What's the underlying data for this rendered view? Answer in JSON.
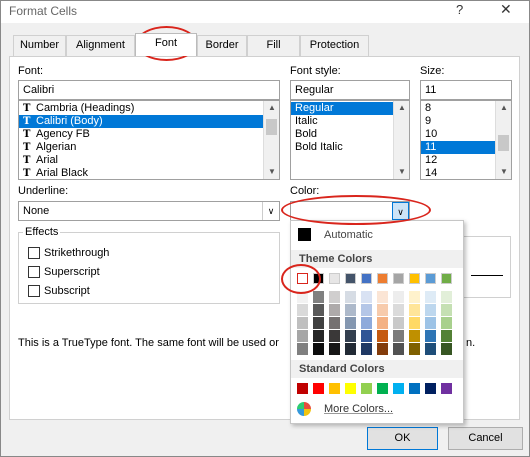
{
  "window": {
    "title": "Format Cells",
    "help": "?",
    "close": "✕"
  },
  "tabs": [
    "Number",
    "Alignment",
    "Font",
    "Border",
    "Fill",
    "Protection"
  ],
  "font": {
    "label": "Font:",
    "value": "Calibri",
    "items": [
      "Cambria (Headings)",
      "Calibri (Body)",
      "Agency FB",
      "Algerian",
      "Arial",
      "Arial Black"
    ],
    "selected_index": 1
  },
  "font_style": {
    "label": "Font style:",
    "value": "Regular",
    "items": [
      "Regular",
      "Italic",
      "Bold",
      "Bold Italic"
    ],
    "selected_index": 0
  },
  "size": {
    "label": "Size:",
    "value": "11",
    "items": [
      "8",
      "9",
      "10",
      "11",
      "12",
      "14"
    ],
    "selected_index": 3
  },
  "underline": {
    "label": "Underline:",
    "value": "None"
  },
  "color": {
    "label": "Color:"
  },
  "effects": {
    "label": "Effects",
    "strikethrough": "Strikethrough",
    "superscript": "Superscript",
    "subscript": "Subscript"
  },
  "info_text": "This is a TrueType font.  The same font will be used or",
  "info_text_tail": "n.",
  "color_popup": {
    "automatic": "Automatic",
    "theme_colors": "Theme Colors",
    "standard_colors": "Standard Colors",
    "more_colors": "More Colors...",
    "theme_row": [
      "#ffffff",
      "#000000",
      "#e7e6e6",
      "#44546a",
      "#4472c4",
      "#ed7d31",
      "#a5a5a5",
      "#ffc000",
      "#5b9bd5",
      "#70ad47"
    ],
    "theme_columns": [
      [
        "#f2f2f2",
        "#d9d9d9",
        "#bfbfbf",
        "#a6a6a6",
        "#808080"
      ],
      [
        "#808080",
        "#595959",
        "#404040",
        "#262626",
        "#0d0d0d"
      ],
      [
        "#d0cece",
        "#aeaaaa",
        "#757171",
        "#3a3838",
        "#171616"
      ],
      [
        "#d6dce4",
        "#adb9ca",
        "#8497b0",
        "#333f4f",
        "#222a35"
      ],
      [
        "#d9e2f3",
        "#b4c6e7",
        "#8eaadb",
        "#2f5496",
        "#1f3864"
      ],
      [
        "#fbe5d5",
        "#f7cbac",
        "#f4b183",
        "#c55a11",
        "#833c0b"
      ],
      [
        "#ededed",
        "#dbdbdb",
        "#c9c9c9",
        "#7b7b7b",
        "#525252"
      ],
      [
        "#fff2cc",
        "#ffe599",
        "#ffd965",
        "#bf9000",
        "#7f6000"
      ],
      [
        "#deebf6",
        "#bdd7ee",
        "#9dc3e6",
        "#2e75b5",
        "#1e4e79"
      ],
      [
        "#e2efd9",
        "#c5e0b3",
        "#a8d08d",
        "#538135",
        "#375623"
      ]
    ],
    "standard_row": [
      "#c00000",
      "#ff0000",
      "#ffc000",
      "#ffff00",
      "#92d050",
      "#00b050",
      "#00b0f0",
      "#0070c0",
      "#002060",
      "#7030a0"
    ]
  },
  "buttons": {
    "ok": "OK",
    "cancel": "Cancel"
  },
  "colors": {
    "selection": "#0078d7",
    "annotation": "#d9251c"
  }
}
